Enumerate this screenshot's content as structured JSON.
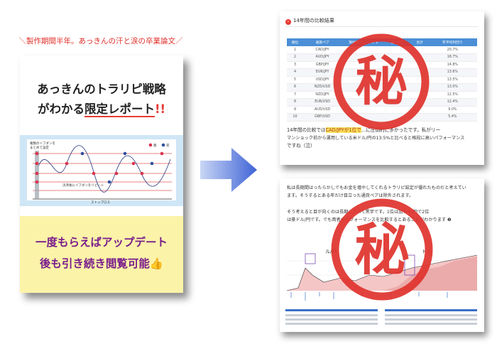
{
  "cover": {
    "tagline": "＼製作期間半年。あっきんの汗と涙の卒業論文／",
    "title_line1": "あっきんのトラリピ戦略",
    "title_line2_a": "がわかる",
    "title_line2_highlight": "限定レポート",
    "title_line2_excl": "!!",
    "chart_note1": "複数のイフダンを",
    "chart_note2": "まとめて設定",
    "chart_note3": "決済後にイフダンをリピート",
    "legend_buy": "買",
    "legend_sell": "売",
    "axis_label": "ストップロス",
    "sub_line1": "一度もらえばアップデート",
    "sub_line2": "後も引き続き閲覧可能👍"
  },
  "shot1": {
    "heading": "14年間の比較結果",
    "headers": [
      "順位",
      "通貨ペア",
      "損益額",
      "ﾏﾌﾟﾛ",
      "最大DD",
      "合計",
      "年平均利回り"
    ],
    "rows": [
      [
        "1",
        "CAD/JPY",
        "",
        "",
        "",
        "",
        "20.7%"
      ],
      [
        "2",
        "AUD/JPY",
        "",
        "",
        "",
        "",
        "18.7%"
      ],
      [
        "3",
        "GBP/JPY",
        "",
        "",
        "",
        "",
        "14.8%"
      ],
      [
        "4",
        "EUR/JPY",
        "",
        "",
        "",
        "",
        "13.6%"
      ],
      [
        "5",
        "USD/JPY",
        "",
        "",
        "",
        "",
        "13.5%"
      ],
      [
        "6",
        "NZD/USD",
        "",
        "",
        "",
        "",
        "13.0%"
      ],
      [
        "7",
        "NZD/JPY",
        "",
        "",
        "",
        "",
        "12.5%"
      ],
      [
        "8",
        "EUR/USD",
        "",
        "",
        "",
        "",
        "12.4%"
      ],
      [
        "9",
        "AUD/USD",
        "",
        "",
        "",
        "",
        "9.0%"
      ],
      [
        "10",
        "GBP/USD",
        "",
        "",
        "",
        "",
        "5.4%"
      ]
    ],
    "para_a": "14年間の比較では",
    "para_highlight": "CAD/JPYが1位で",
    "para_b": "…に圧倒的に多かったです。私がリー",
    "para_line2": "マンショック前から運用している米ドル/円の13.5%と比べると格段に高いパフォーマンス",
    "para_line3": "ですね（泣）"
  },
  "shot2": {
    "para1_line1": "私は長期間はったらかしでもお金を増やしてくれるトラリピ設定が優れたものだと考えてい",
    "para1_line2": "ます。そうするとある年だけ目立った通貨ペアは除外されます。",
    "para2_line1": "そう考えると目が向くのは長期…すべて黒字です。1位は加ドル/円で2位",
    "para2_line2": "は豪ドル/円です。でも両者のパフォーマンスを比較するとあることがわかります ❷",
    "chart_label_left": "ル/円",
    "chart_label_right": "ドル"
  },
  "seal_text": "秘",
  "colors": {
    "accent_red": "#e63b32",
    "purple": "#7a1e8c",
    "table_header_blue": "#4b8fd6",
    "arrow_blue": "#3f63d6",
    "cover_yellow": "#fbf3a8"
  },
  "icons": [
    "right-arrow-icon",
    "seal-stamp-icon",
    "thumbs-up-icon",
    "section-bullet-icon"
  ]
}
